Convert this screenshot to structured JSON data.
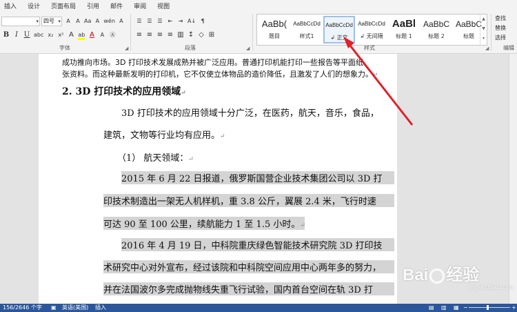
{
  "menu": [
    "插入",
    "设计",
    "页面布局",
    "引用",
    "邮件",
    "审阅",
    "视图"
  ],
  "ribbon": {
    "font": {
      "name_value": "",
      "size_value": "四号",
      "group_label": "字体",
      "top_icons": [
        "A",
        "A",
        "Aa",
        "A",
        "wén",
        "A"
      ],
      "bottom_icons": [
        "B",
        "I",
        "U",
        "abc",
        "x₂",
        "x²",
        "A",
        "ab",
        "A",
        "A",
        "Ⓐ"
      ]
    },
    "paragraph": {
      "group_label": "段落",
      "top_icons": [
        "☰",
        "☰",
        "☰",
        "⇤",
        "⇥",
        "A↓",
        "¶"
      ],
      "bottom_icons": [
        "≡",
        "≡",
        "≡",
        "≡",
        "▥",
        "↕",
        "◇",
        "⊞"
      ]
    },
    "styles": {
      "group_label": "样式",
      "items": [
        {
          "preview": "AaBb(",
          "name": "题目"
        },
        {
          "preview": "AaBbCcDd",
          "name": "样式1"
        },
        {
          "preview": "AaBbCcDd",
          "name": "↲ 正文",
          "active": true
        },
        {
          "preview": "AaBbCcDd",
          "name": "↲ 无间隔"
        },
        {
          "preview": "AaBl",
          "name": "标题 1"
        },
        {
          "preview": "AaBbC",
          "name": "标题 2"
        },
        {
          "preview": "AaBbC",
          "name": "标题"
        }
      ]
    },
    "editing": {
      "group_label": "编辑",
      "items": [
        "查找",
        "替换",
        "选择"
      ]
    }
  },
  "document": {
    "lines": [
      "成功推向市场。3D 打印技术发展成熟并被广泛应用。普通打印机能打印一些报告等平面纸",
      "张资料。而这种最新发明的打印机，它不仅使立体物品的造价降低，且激发了人们的想象力。"
    ],
    "heading": "2.   3D 打印技术的应用领域",
    "para1": [
      "3D 打印技术的应用领域十分广泛，在医药，航天，音乐，食品，",
      "建筑，文物等行业均有应用。"
    ],
    "subheading": "（1）    航天领域：",
    "para2": [
      "2015 年 6 月 22 日报道，俄罗斯国营企业技术集团公司以 3D 打",
      "印技术制造出一架无人机样机，重 3.8 公斤，翼展 2.4 米，飞行时速",
      "可达 90 至 100 公里，续航能力 1 至 1.5 小时。"
    ],
    "para3": [
      "2016 年 4 月 19 日，中科院重庆绿色智能技术研究院 3D 打印技",
      "术研究中心对外宣布，经过该院和中科院空间应用中心两年多的努力，",
      "并在法国波尔多完成抛物线失重飞行试验，国内首台空间在轨 3D 打"
    ]
  },
  "status": {
    "words": "156/2646 个字",
    "lang": "英语(美国)",
    "mode": "插入"
  },
  "watermark": {
    "text_left": "Bai",
    "text_right": "经验",
    "sub": "jingyan.baidu.com"
  },
  "colors": {
    "accent": "#2b579a",
    "arrow": "#e0202a",
    "selection": "#d4d4d4"
  }
}
